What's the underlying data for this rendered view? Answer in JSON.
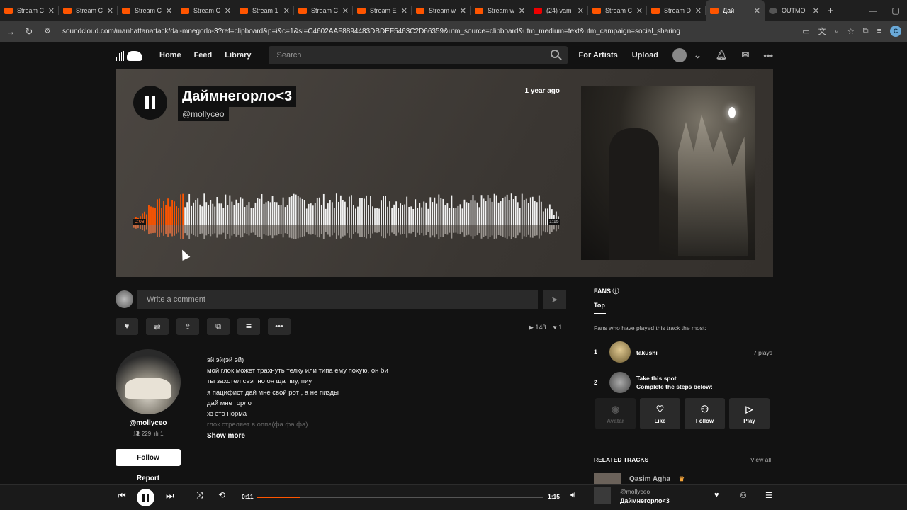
{
  "browser": {
    "tabs": [
      {
        "title": "Stream C",
        "icon": "soundcloud-icon"
      },
      {
        "title": "Stream C",
        "icon": "soundcloud-icon"
      },
      {
        "title": "Stream C",
        "icon": "soundcloud-icon"
      },
      {
        "title": "Stream C",
        "icon": "soundcloud-icon"
      },
      {
        "title": "Stream 1",
        "icon": "soundcloud-icon"
      },
      {
        "title": "Stream C",
        "icon": "soundcloud-icon"
      },
      {
        "title": "Stream E",
        "icon": "soundcloud-icon"
      },
      {
        "title": "Stream w",
        "icon": "soundcloud-icon"
      },
      {
        "title": "Stream w",
        "icon": "soundcloud-icon"
      },
      {
        "title": "(24) vam",
        "icon": "youtube-icon"
      },
      {
        "title": "Stream C",
        "icon": "soundcloud-icon"
      },
      {
        "title": "Stream D",
        "icon": "soundcloud-icon"
      },
      {
        "title": "Дай",
        "icon": "soundcloud-icon",
        "active": true
      },
      {
        "title": "OUTMO",
        "icon": "generic-icon"
      }
    ],
    "url": "soundcloud.com/manhattanattack/dai-mnegorlo-3?ref=clipboard&p=i&c=1&si=C4602AAF8894483DBDEF5463C2D66359&utm_source=clipboard&utm_medium=text&utm_campaign=social_sharing",
    "profile_initial": "C"
  },
  "header": {
    "nav": [
      "Home",
      "Feed",
      "Library"
    ],
    "search_placeholder": "Search",
    "for_artists": "For Artists",
    "upload": "Upload"
  },
  "hero": {
    "title": "Даймнегорло<3",
    "user": "@mollyceo",
    "ago": "1 year ago",
    "time_current": "0:08",
    "time_total": "1:15",
    "progress": 0.12
  },
  "comment": {
    "placeholder": "Write a comment"
  },
  "stats": {
    "plays": "148",
    "likes": "1"
  },
  "uploader": {
    "name": "@mollyceo",
    "followers": "229",
    "tracks": "1",
    "follow_label": "Follow",
    "report_label": "Report"
  },
  "lyrics": {
    "lines": [
      "эй эй(эй эй)",
      "мой глок может трахнуть телку или типа ему похую, он би",
      "ты захотел свэг но он ща пиу, пиу",
      "я пацифист дай мне свой рот , а не пизды",
      "дай мне горло",
      "хз это норма"
    ],
    "faded": "глок стреляет в оппа(фа фа фа)",
    "show_more": "Show more"
  },
  "fans": {
    "heading": "FANS",
    "tab": "Top",
    "desc": "Fans who have played this track the most:",
    "first": {
      "rank": "1",
      "name": "takushi",
      "plays": "7 plays"
    },
    "second": {
      "rank": "2",
      "title": "Take this spot",
      "sub": "Complete the steps below:"
    },
    "buttons": [
      "Avatar",
      "Like",
      "Follow",
      "Play"
    ]
  },
  "related": {
    "heading": "RELATED TRACKS",
    "view_all": "View all",
    "first_artist": "Qasim Agha"
  },
  "player": {
    "current": "0:11",
    "total": "1:15",
    "progress": 0.15,
    "user": "@mollyceo",
    "title": "Даймнегорло<3"
  },
  "colors": {
    "accent": "#ff5500",
    "background": "#121212"
  }
}
